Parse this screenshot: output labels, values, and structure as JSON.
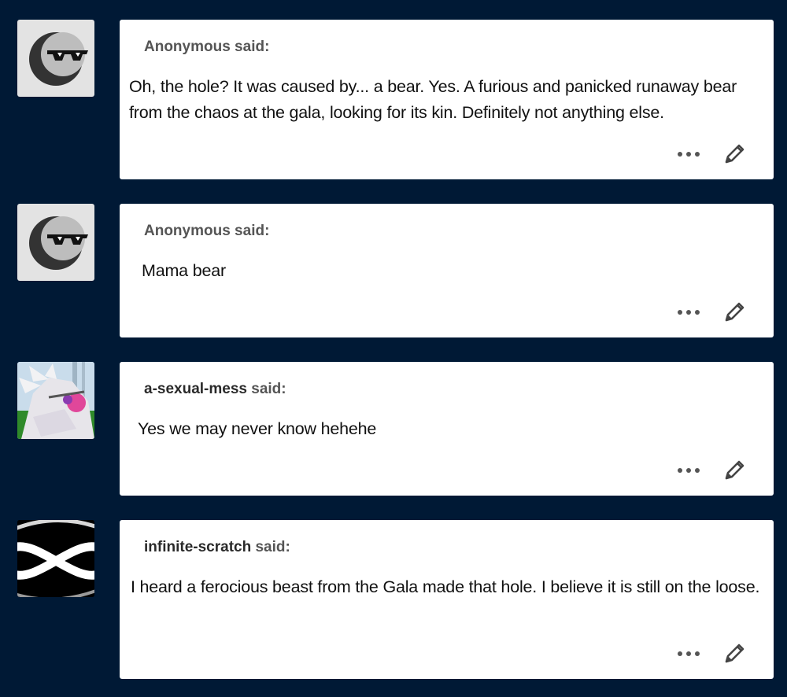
{
  "posts": [
    {
      "user": "Anonymous said:",
      "user_name": "",
      "said_label": "",
      "text": "Oh, the hole? It was caused by... a bear. Yes. A furious and panicked runaway bear from the chaos at the gala, looking for its kin. Definitely not anything else.",
      "avatar_icon": "anonymous-sunglasses-icon"
    },
    {
      "user": "Anonymous said:",
      "user_name": "",
      "said_label": "",
      "text": "Mama bear",
      "avatar_icon": "anonymous-sunglasses-icon"
    },
    {
      "user": "",
      "user_name": "a-sexual-mess",
      "said_label": "said:",
      "text": "Yes we may never know hehehe",
      "avatar_icon": "character-avatar"
    },
    {
      "user": "",
      "user_name": "infinite-scratch",
      "said_label": "said:",
      "text": "I heard a ferocious beast from the Gala made that hole. I believe it is still on the loose.",
      "avatar_icon": "infinity-logo-avatar"
    }
  ],
  "icons": {
    "more": "more-options-icon",
    "edit": "pencil-icon"
  },
  "colors": {
    "background": "#001935",
    "card": "#ffffff"
  }
}
